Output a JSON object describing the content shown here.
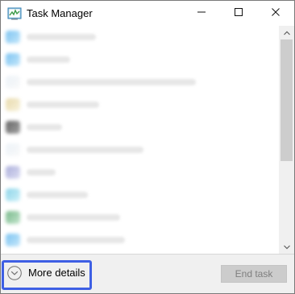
{
  "window": {
    "title": "Task Manager",
    "app_icon": "task-manager-icon",
    "controls": {
      "minimize_icon": "minimize-icon",
      "maximize_icon": "maximize-icon",
      "close_icon": "close-icon"
    }
  },
  "process_list": {
    "rows": [
      {
        "icon": "blue",
        "name": ""
      },
      {
        "icon": "blue",
        "name": ""
      },
      {
        "icon": "light",
        "name": ""
      },
      {
        "icon": "yellow",
        "name": ""
      },
      {
        "icon": "gray",
        "name": ""
      },
      {
        "icon": "light",
        "name": ""
      },
      {
        "icon": "purple",
        "name": ""
      },
      {
        "icon": "teal",
        "name": ""
      },
      {
        "icon": "green",
        "name": ""
      },
      {
        "icon": "blue",
        "name": ""
      }
    ]
  },
  "scrollbar": {
    "up_icon": "chevron-up-icon",
    "down_icon": "chevron-down-icon"
  },
  "footer": {
    "more_details_label": "More details",
    "more_details_icon": "chevron-down-circle-icon",
    "end_task_label": "End task"
  },
  "colors": {
    "accent": "#3e5fe4",
    "footer_background": "#f0f0f0",
    "disabled_button": "#cccccc",
    "disabled_text": "#7f7f7f",
    "scroll_thumb": "#cdcdcd"
  }
}
